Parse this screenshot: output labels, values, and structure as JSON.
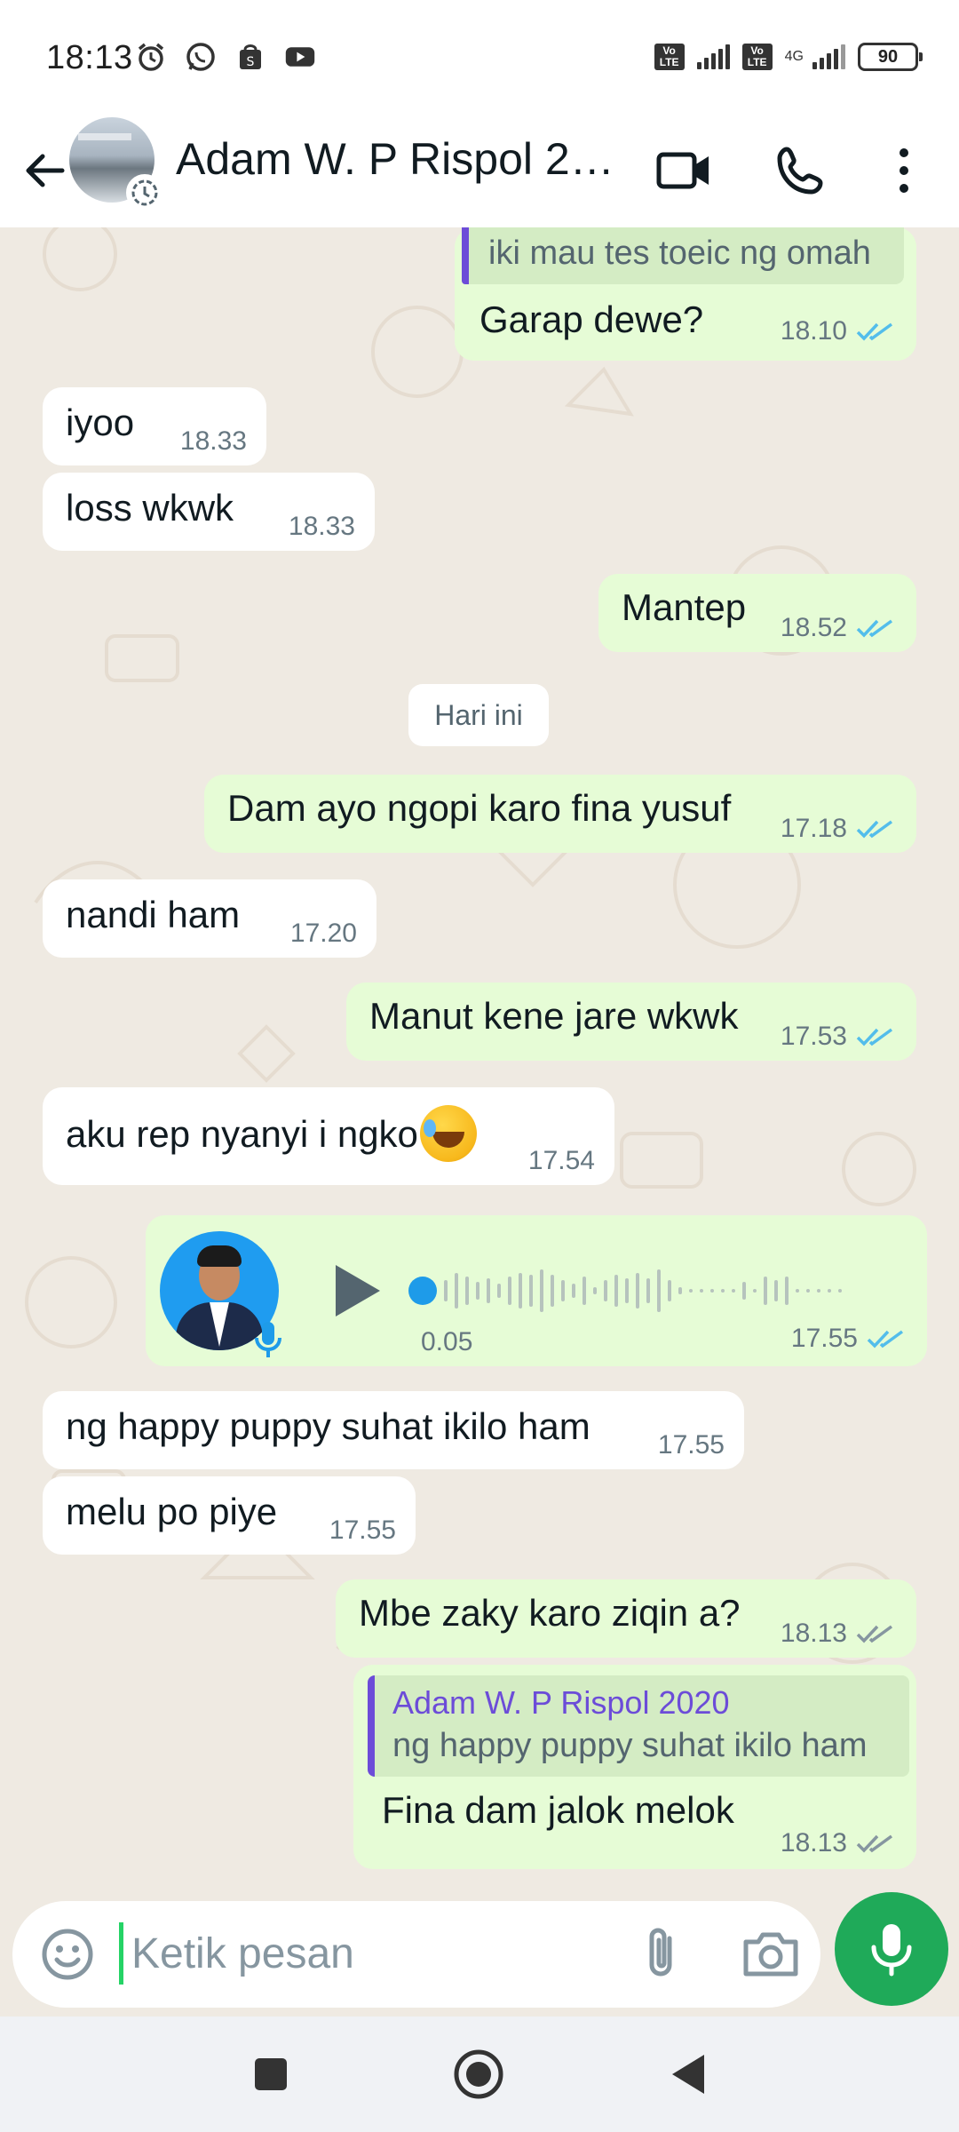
{
  "status_bar": {
    "time": "18:13",
    "battery": "90",
    "network": "4G",
    "volte": "Vo LTE"
  },
  "header": {
    "contact_name": "Adam W. P Rispol 20..."
  },
  "messages": [
    {
      "dir": "out",
      "quote": "iki mau tes toeic ng omah",
      "text": "Garap dewe?",
      "time": "18.10",
      "ticks": "read"
    },
    {
      "dir": "in",
      "text": "iyoo",
      "time": "18.33"
    },
    {
      "dir": "in",
      "text": "loss wkwk",
      "time": "18.33"
    },
    {
      "dir": "out",
      "text": "Mantep",
      "time": "18.52",
      "ticks": "read"
    },
    {
      "dir": "out",
      "text": "Dam ayo ngopi karo fina yusuf",
      "time": "17.18",
      "ticks": "read"
    },
    {
      "dir": "in",
      "text": "nandi ham",
      "time": "17.20"
    },
    {
      "dir": "out",
      "text": "Manut kene jare wkwk",
      "time": "17.53",
      "ticks": "read"
    },
    {
      "dir": "in",
      "text": "aku rep nyanyi i ngko",
      "emoji": "rolling-on-floor-laughing",
      "time": "17.54"
    },
    {
      "dir": "in",
      "text": "ng happy puppy suhat ikilo ham",
      "time": "17.55"
    },
    {
      "dir": "in",
      "text": "melu po piye",
      "time": "17.55"
    },
    {
      "dir": "out",
      "text": "Mbe zaky karo ziqin a?",
      "time": "18.13",
      "ticks": "delivered"
    },
    {
      "dir": "out",
      "quote_name": "Adam W. P Rispol 2020",
      "quote": "ng happy puppy suhat ikilo ham",
      "text": "Fina dam jalok melok",
      "time": "18.13",
      "ticks": "delivered"
    }
  ],
  "date_divider": "Hari ini",
  "voice_message": {
    "duration": "0.05",
    "time": "17.55",
    "ticks": "read"
  },
  "composer": {
    "placeholder": "Ketik pesan"
  },
  "colors": {
    "outgoing_bubble": "#e6fcd6",
    "incoming_bubble": "#ffffff",
    "chat_background": "#efeae2",
    "read_tick": "#53bdeb",
    "accent_green": "#1faa59",
    "quote_accent": "#6c4cd8"
  },
  "icons": {
    "back": "back-arrow-icon",
    "video": "video-call-icon",
    "call": "phone-icon",
    "menu": "more-vert-icon",
    "emoji": "emoji-icon",
    "attach": "paperclip-icon",
    "camera": "camera-icon",
    "mic": "mic-icon"
  }
}
